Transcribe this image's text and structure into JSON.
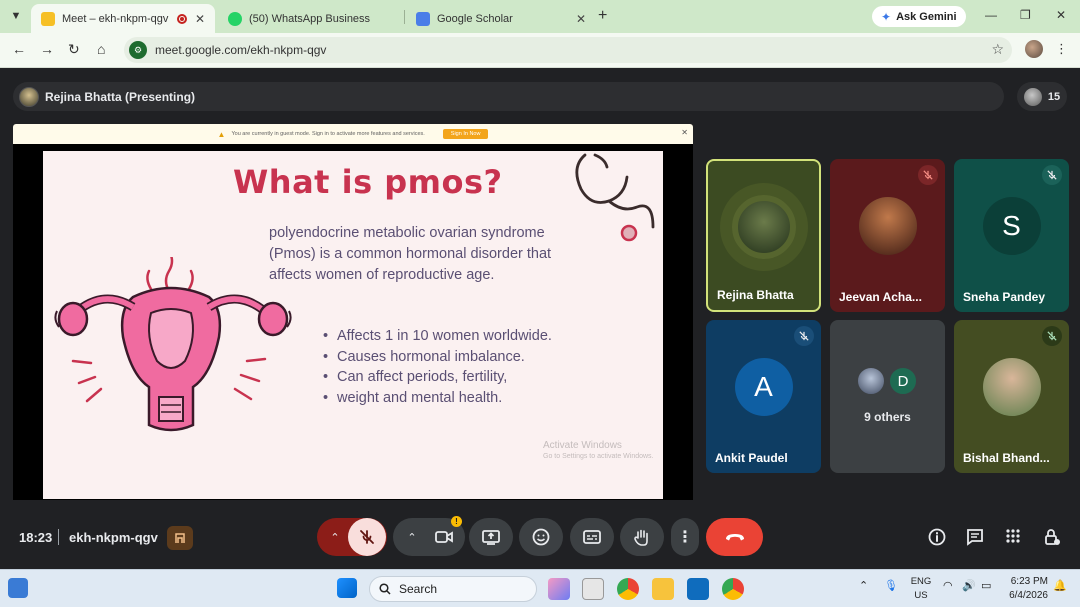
{
  "browser": {
    "tabs": [
      {
        "label": "Meet – ekh-nkpm-qgv",
        "active": true,
        "recording": true
      },
      {
        "label": "(50) WhatsApp Business",
        "active": false
      },
      {
        "label": "Google Scholar",
        "active": false
      }
    ],
    "new_tab": "+",
    "ask_gemini": "Ask Gemini",
    "url": "meet.google.com/ekh-nkpm-qgv"
  },
  "meet": {
    "presenter_label": "Rejina Bhatta (Presenting)",
    "participant_count": "15",
    "guest_banner": {
      "message": "You are currently in guest mode. Sign in to activate more features and services.",
      "sign_in": "Sign In Now"
    },
    "slide": {
      "title": "What is pmos?",
      "definition": "polyendocrine metabolic ovarian syndrome (Pmos) is a common hormonal disorder that affects women of reproductive age.",
      "bullets": [
        "Affects 1 in 10 women worldwide.",
        "Causes hormonal  imbalance.",
        "Can affect periods, fertility,",
        "weight and mental health."
      ],
      "watermark_line1": "Activate Windows",
      "watermark_line2": "Go to Settings to activate Windows."
    },
    "tiles": [
      {
        "name": "Rejina Bhatta",
        "muted": false,
        "speaking": true
      },
      {
        "name": "Jeevan Acha...",
        "muted": true
      },
      {
        "name": "Sneha Pandey",
        "letter": "S",
        "muted": true
      },
      {
        "name": "Ankit Paudel",
        "letter": "A",
        "muted": true
      },
      {
        "others": "9 others",
        "letter": "D"
      },
      {
        "name": "Bishal Bhand...",
        "muted": true
      }
    ],
    "colors": {
      "accent_tile_border": "#d2e27a",
      "end_call": "#ea4335",
      "mic_off_group": "#8c1d18"
    },
    "bottom": {
      "time": "18:23",
      "meeting_code": "ekh-nkpm-qgv"
    }
  },
  "taskbar": {
    "search_placeholder": "Search",
    "lang_line1": "ENG",
    "lang_line2": "US",
    "time": "6:23 PM",
    "date": "6/4/2026"
  }
}
